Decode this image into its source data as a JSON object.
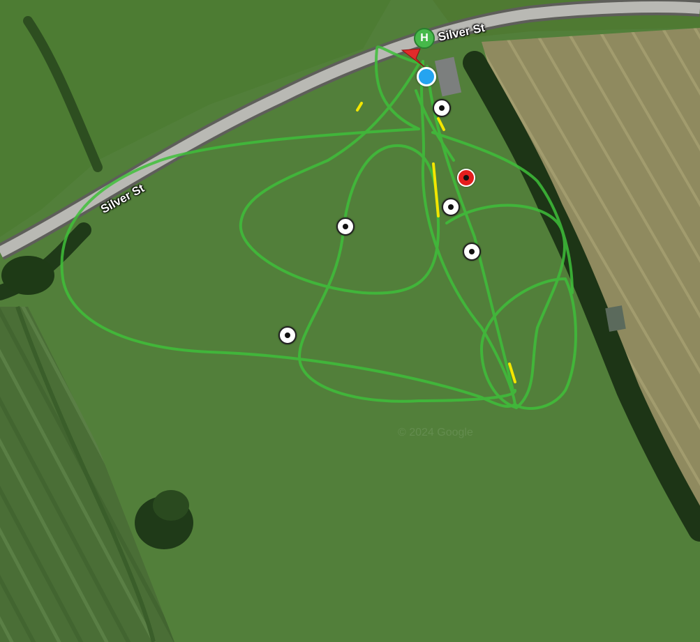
{
  "map": {
    "type": "satellite",
    "road_labels": [
      "Silver St",
      "Silver St"
    ],
    "watermark": "© 2024 Google",
    "home_marker_label": "H"
  },
  "waypoints": [
    {
      "name": "waypoint-1",
      "active": false
    },
    {
      "name": "waypoint-2",
      "active": true
    },
    {
      "name": "waypoint-3",
      "active": false
    },
    {
      "name": "waypoint-4",
      "active": false
    },
    {
      "name": "waypoint-5",
      "active": false
    },
    {
      "name": "waypoint-6",
      "active": false
    }
  ],
  "colors": {
    "flight_path": "#3fbf3a",
    "path_highlight": "#f3e600",
    "active_waypoint": "#e41d1d",
    "drone_position": "#25a4f0",
    "heading_arrow": "#e22b2b",
    "home_marker": "#46b94a",
    "road": "#b9b9b4"
  },
  "icons": {
    "home": "home-marker-icon",
    "drone": "drone-position-icon",
    "heading": "heading-arrow-icon",
    "waypoint": "waypoint-target-icon"
  }
}
